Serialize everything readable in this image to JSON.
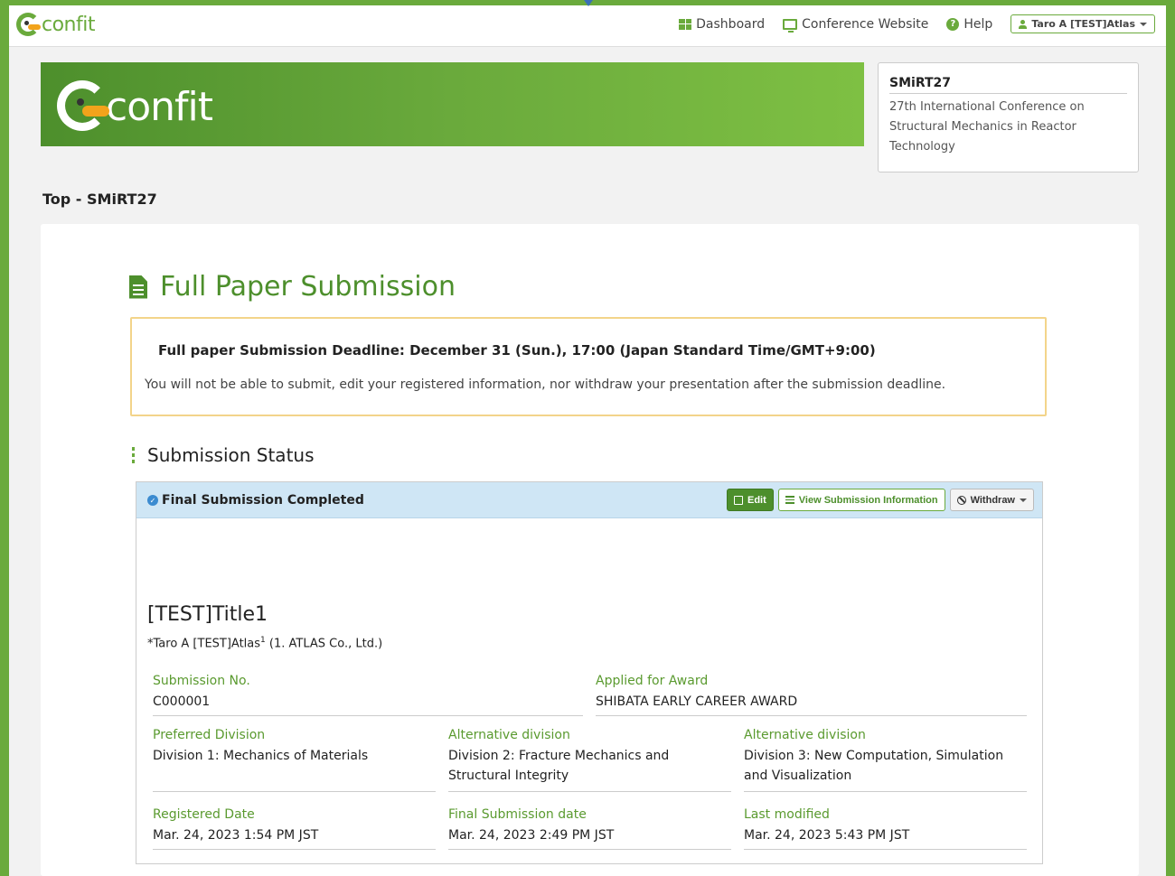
{
  "navbar": {
    "logo_text": "confit",
    "links": [
      {
        "label": "Dashboard",
        "icon": "dashboard-grid-icon"
      },
      {
        "label": "Conference Website",
        "icon": "monitor-icon"
      },
      {
        "label": "Help",
        "icon": "help-icon"
      }
    ],
    "user_label": "Taro A [TEST]Atlas"
  },
  "banner": {
    "logo_text": "confit"
  },
  "conference": {
    "abbr": "SMiRT27",
    "name": "27th International Conference on Structural Mechanics in Reactor Technology"
  },
  "breadcrumb": "Top - SMiRT27",
  "page": {
    "title": "Full Paper Submission",
    "notice_deadline": "Full paper Submission Deadline: December 31 (Sun.), 17:00 (Japan Standard Time/GMT+9:00)",
    "notice_message": "You will not be able to submit, edit your registered information, nor withdraw your presentation after the submission deadline."
  },
  "submission_status": {
    "section_title": "Submission Status",
    "status_label": "Final Submission Completed",
    "actions": {
      "edit": "Edit",
      "view": "View Submission Information",
      "withdraw": "Withdraw"
    },
    "paper_title": "[TEST]Title1",
    "author_prefix": "*Taro A [TEST]Atlas",
    "author_sup": "1",
    "author_affiliation": " (1. ATLAS Co., Ltd.)",
    "fields": {
      "submission_no": {
        "label": "Submission No.",
        "value": "C000001"
      },
      "applied_award": {
        "label": "Applied for Award",
        "value": "SHIBATA EARLY CAREER AWARD"
      },
      "preferred_division": {
        "label": "Preferred Division",
        "value": "Division 1: Mechanics of Materials"
      },
      "alt_division_1": {
        "label": "Alternative division",
        "value": "Division 2: Fracture Mechanics and Structural Integrity"
      },
      "alt_division_2": {
        "label": "Alternative division",
        "value": "Division 3: New Computation, Simulation and Visualization"
      },
      "registered_date": {
        "label": "Registered Date",
        "value": "Mar. 24, 2023 1:54 PM JST"
      },
      "final_submission_date": {
        "label": "Final Submission date",
        "value": "Mar. 24, 2023 2:49 PM JST"
      },
      "last_modified": {
        "label": "Last modified",
        "value": "Mar. 24, 2023 5:43 PM JST"
      }
    }
  },
  "colors": {
    "brand_green": "#6aaa3c",
    "dark_green": "#4d8f2c",
    "notice_border": "#f3d48a",
    "status_bg": "#cfe6f5",
    "duck_beak": "#f2a31b"
  }
}
